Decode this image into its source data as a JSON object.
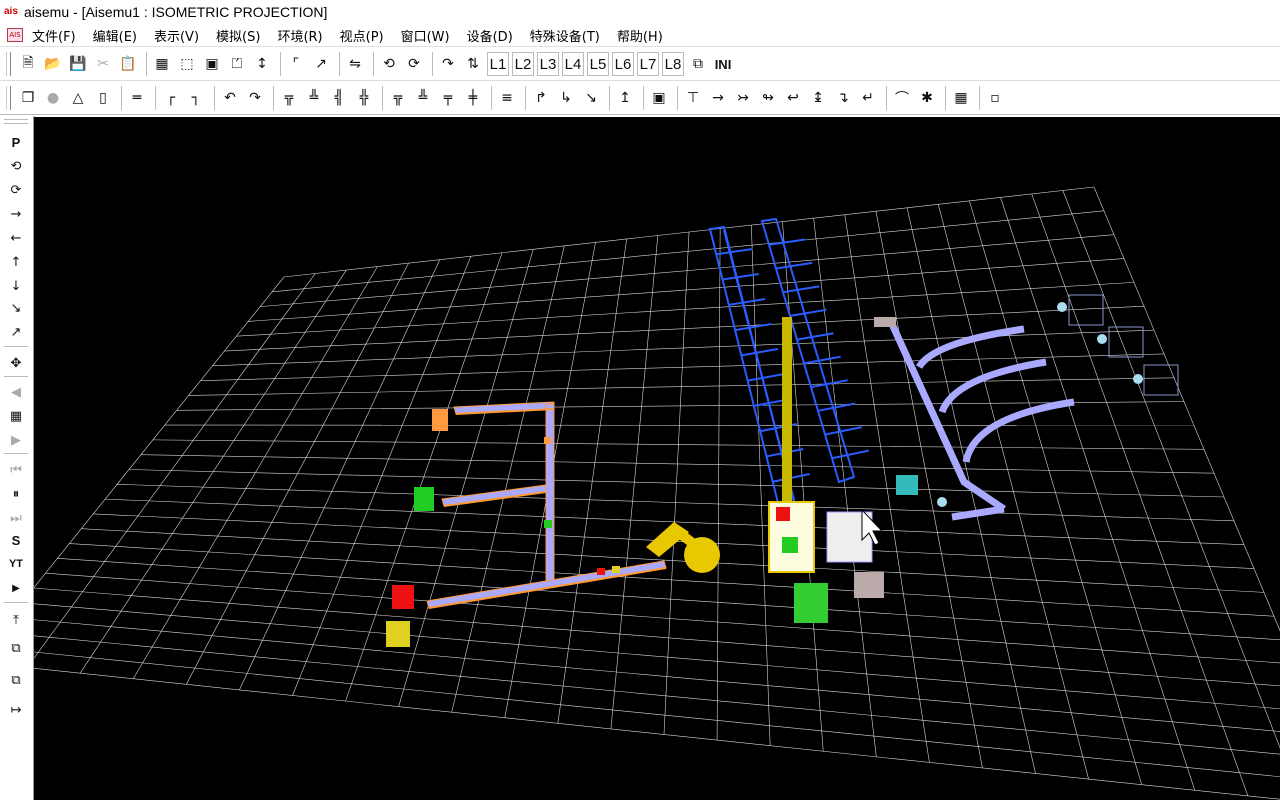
{
  "window": {
    "app_icon_text": "ais",
    "title": "aisemu - [Aisemu1 : ISOMETRIC PROJECTION]"
  },
  "menubar": {
    "doc_icon": "document-icon",
    "items": [
      {
        "label": "文件(F)"
      },
      {
        "label": "编辑(E)"
      },
      {
        "label": "表示(V)"
      },
      {
        "label": "模拟(S)"
      },
      {
        "label": "环境(R)"
      },
      {
        "label": "视点(P)"
      },
      {
        "label": "窗口(W)"
      },
      {
        "label": "设备(D)"
      },
      {
        "label": "特殊设备(T)"
      },
      {
        "label": "帮助(H)"
      }
    ]
  },
  "toolbar1": {
    "layer_buttons": [
      "L1",
      "L2",
      "L3",
      "L4",
      "L5",
      "L6",
      "L7",
      "L8"
    ],
    "ini_label": "INI"
  },
  "left_toolbar": {
    "text_buttons": {
      "p": "P",
      "s": "S",
      "yt": "YT"
    }
  },
  "viewport": {
    "background": "#000000",
    "grid_color": "#d8d8d8",
    "rack_color": "#2a5cff",
    "conveyor_color": "#a9a9ff",
    "conveyor_frame_color": "#ff9933",
    "robot_color": "#e8c800"
  }
}
